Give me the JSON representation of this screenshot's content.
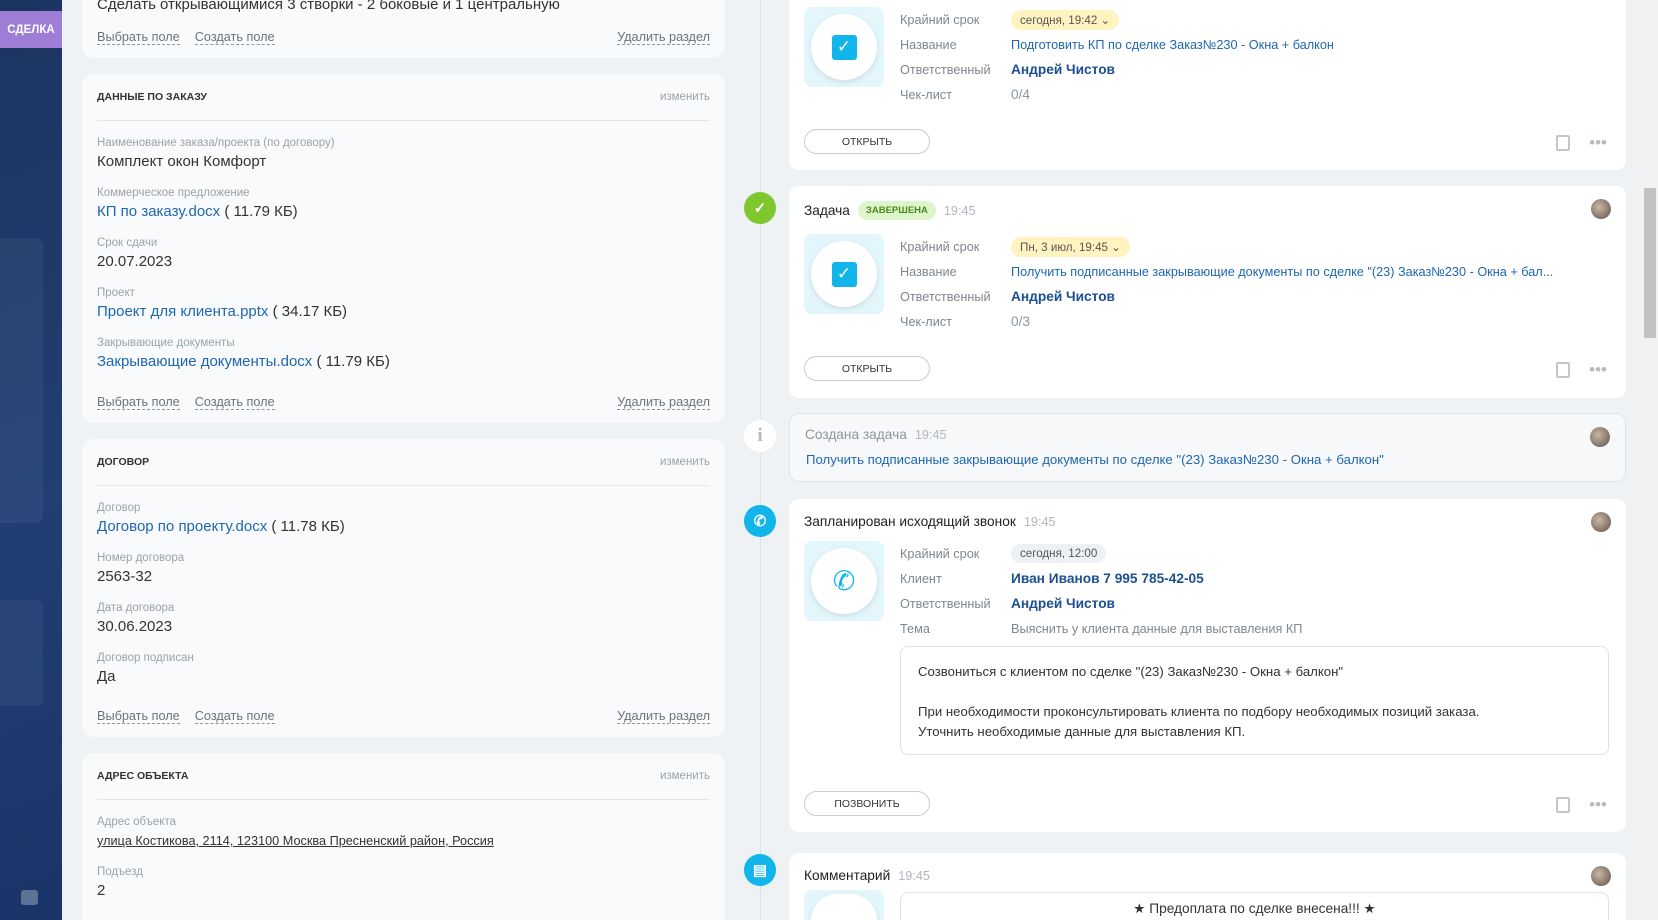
{
  "sidebar": {
    "tab": "СДЕЛКА",
    "print_icon": "printer-icon"
  },
  "left": {
    "top_card": {
      "text": "Сделать открывающимися 3 створки - 2 боковые и 1 центральную"
    },
    "actions": {
      "select": "Выбрать поле",
      "create": "Создать поле",
      "delete": "Удалить раздел"
    },
    "change": "изменить",
    "order": {
      "title": "ДАННЫЕ ПО ЗАКАЗУ",
      "fields": [
        {
          "label": "Наименование заказа/проекта (по договору)",
          "value": "Комплект окон Комфорт"
        },
        {
          "label": "Коммерческое предложение",
          "link": "КП по заказу.docx",
          "size": " ( 11.79 КБ)"
        },
        {
          "label": "Срок сдачи",
          "value": "20.07.2023"
        },
        {
          "label": "Проект",
          "link": "Проект для клиента.pptx",
          "size": " ( 34.17 КБ)"
        },
        {
          "label": "Закрывающие документы",
          "link": "Закрывающие документы.docx",
          "size": " ( 11.79 КБ)"
        }
      ]
    },
    "contract": {
      "title": "ДОГОВОР",
      "fields": [
        {
          "label": "Договор",
          "link": "Договор по проекту.docx",
          "size": " ( 11.78 КБ)"
        },
        {
          "label": "Номер договора",
          "value": "2563-32"
        },
        {
          "label": "Дата договора",
          "value": "30.06.2023"
        },
        {
          "label": "Договор подписан",
          "value": "Да"
        }
      ]
    },
    "address": {
      "title": "АДРЕС ОБЪЕКТА",
      "fields": [
        {
          "label": "Адрес объекта",
          "value": "улица Костикова, 2114, 123100 Москва Пресненский район, Россия"
        },
        {
          "label": "Подъезд",
          "value": "2"
        }
      ]
    }
  },
  "labels": {
    "deadline": "Крайний срок",
    "name": "Название",
    "responsible": "Ответственный",
    "checklist": "Чек-лист",
    "client": "Клиент",
    "topic": "Тема"
  },
  "timeline": {
    "task1": {
      "deadline": "сегодня, 19:42",
      "name": "Подготовить КП по сделке Заказ№230 - Окна + балкон",
      "responsible": "Андрей Чистов",
      "checklist": "0/4",
      "button": "ОТКРЫТЬ"
    },
    "task2": {
      "title": "Задача",
      "status": "ЗАВЕРШЕНА",
      "time": "19:45",
      "deadline": "Пн, 3 июл, 19:45",
      "name": "Получить подписанные закрывающие документы по сделке \"(23) Заказ№230 - Окна + бал...",
      "responsible": "Андрей Чистов",
      "checklist": "0/3",
      "button": "ОТКРЫТЬ"
    },
    "created": {
      "title": "Создана задача",
      "time": "19:45",
      "text": "Получить подписанные закрывающие документы по сделке \"(23) Заказ№230 - Окна + балкон\""
    },
    "call": {
      "title": "Запланирован исходящий звонок",
      "time": "19:45",
      "deadline": "сегодня, 12:00",
      "client": "Иван Иванов 7 995 785-42-05",
      "responsible": "Андрей Чистов",
      "topic": "Выяснить у клиента данные для выставления КП",
      "text1": "Созвониться с клиентом по сделке \"(23) Заказ№230 - Окна + балкон\"",
      "text2": "При необходимости проконсультировать клиента по подбору необходимых позиций заказа.",
      "text3": "Уточнить необходимые данные для выставления КП.",
      "button": "ПОЗВОНИТЬ"
    },
    "comment": {
      "title": "Комментарий",
      "time": "19:45",
      "text": "★ Предоплата по сделке внесена!!! ★"
    }
  }
}
